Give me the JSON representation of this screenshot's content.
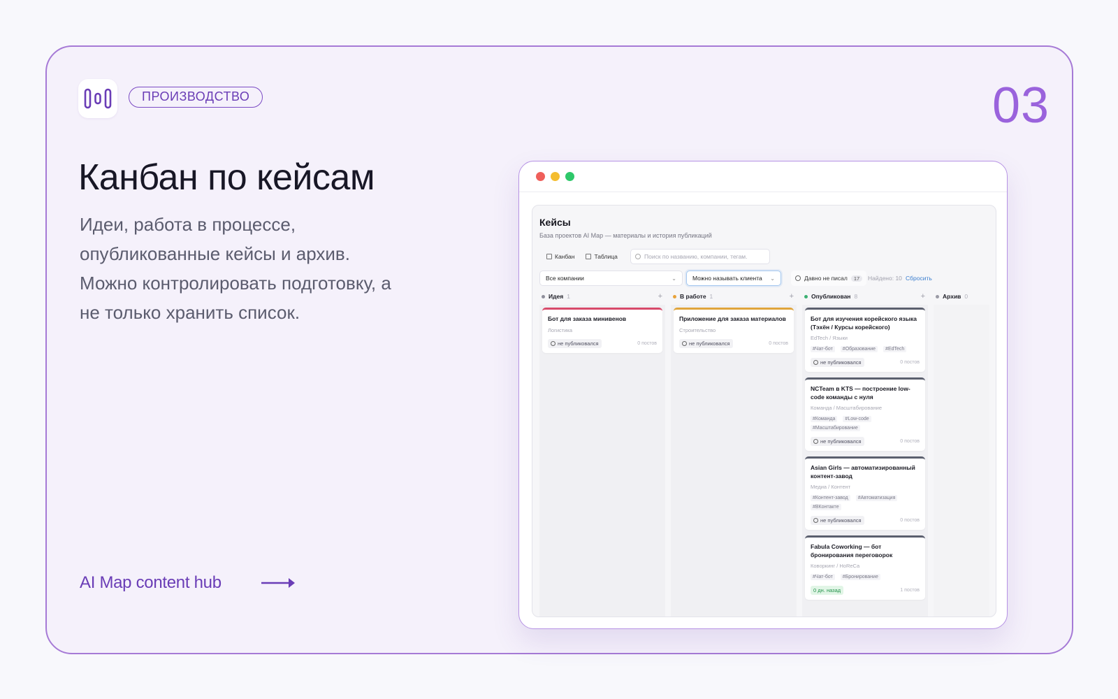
{
  "slide": {
    "badge": "ПРОИЗВОДСТВО",
    "number": "03",
    "title": "Канбан по кейсам",
    "description": "Идеи, работа в процессе, опубликованные кейсы и архив. Можно контролировать подготовку, а не только хранить список.",
    "footer_link": "AI Map content hub",
    "icons": {
      "logo": "ai-map-logo-icon",
      "arrow": "arrow-right-icon"
    },
    "colors": {
      "accent": "#7b4bc4",
      "number": "#9a63dc",
      "border": "#a67ad6"
    }
  },
  "app": {
    "title": "Кейсы",
    "subtitle": "База проектов AI Map — материалы и история публикаций",
    "tabs": [
      {
        "label": "Канбан",
        "icon": "kanban-icon"
      },
      {
        "label": "Таблица",
        "icon": "table-icon"
      }
    ],
    "search_placeholder": "Поиск по названию, компании, тегам.",
    "filters": {
      "company": "Все компании",
      "client": "Можно называть клиента",
      "stale_label": "Давно не писал",
      "stale_count": "17",
      "found": "Найдено: 10",
      "reset": "Сбросить"
    },
    "columns": [
      {
        "name": "Идея",
        "count": "1",
        "color": "#8e8e9a",
        "cards": [
          {
            "title": "Бот для заказа минивенов",
            "meta": "Логистика",
            "tags": [],
            "status": "не публиковался",
            "posts": "0 постов",
            "accent": "#d84a6a"
          }
        ]
      },
      {
        "name": "В работе",
        "count": "1",
        "color": "#e8a23a",
        "cards": [
          {
            "title": "Приложение для заказа материалов",
            "meta": "Строительство",
            "tags": [],
            "status": "не публиковался",
            "posts": "0 постов",
            "accent": "#e0a53c"
          }
        ]
      },
      {
        "name": "Опубликован",
        "count": "8",
        "color": "#3bb072",
        "cards": [
          {
            "title": "Бот для изучения корейского языка (Тэхён / Курсы корейского)",
            "meta": "EdTech / Языки",
            "tags": [
              "#Чат-бот",
              "#Образование",
              "#EdTech"
            ],
            "status": "не публиковался",
            "posts": "0 постов",
            "accent": "#5b5f6e"
          },
          {
            "title": "NCTeam в KTS — построение low-code команды с нуля",
            "meta": "Команда / Масштабирование",
            "tags": [
              "#Команда",
              "#Low-code",
              "#Масштабирование"
            ],
            "status": "не публиковался",
            "posts": "0 постов",
            "accent": "#5b5f6e"
          },
          {
            "title": "Asian Girls — автоматизированный контент-завод",
            "meta": "Медиа / Контент",
            "tags": [
              "#Контент-завод",
              "#Автоматизация",
              "#ВКонтакте"
            ],
            "status": "не публиковался",
            "posts": "0 постов",
            "accent": "#5b5f6e"
          },
          {
            "title": "Fabula Coworking — бот бронирования переговорок",
            "meta": "Коворкинг / HoReCa",
            "tags": [
              "#Чат-бот",
              "#Бронирование"
            ],
            "status": "0 дн. назад",
            "posts": "1 постов",
            "accent": "#5b5f6e",
            "status_green": true
          }
        ]
      },
      {
        "name": "Архив",
        "count": "0",
        "color": "#9a9aa5",
        "cards": []
      }
    ]
  }
}
